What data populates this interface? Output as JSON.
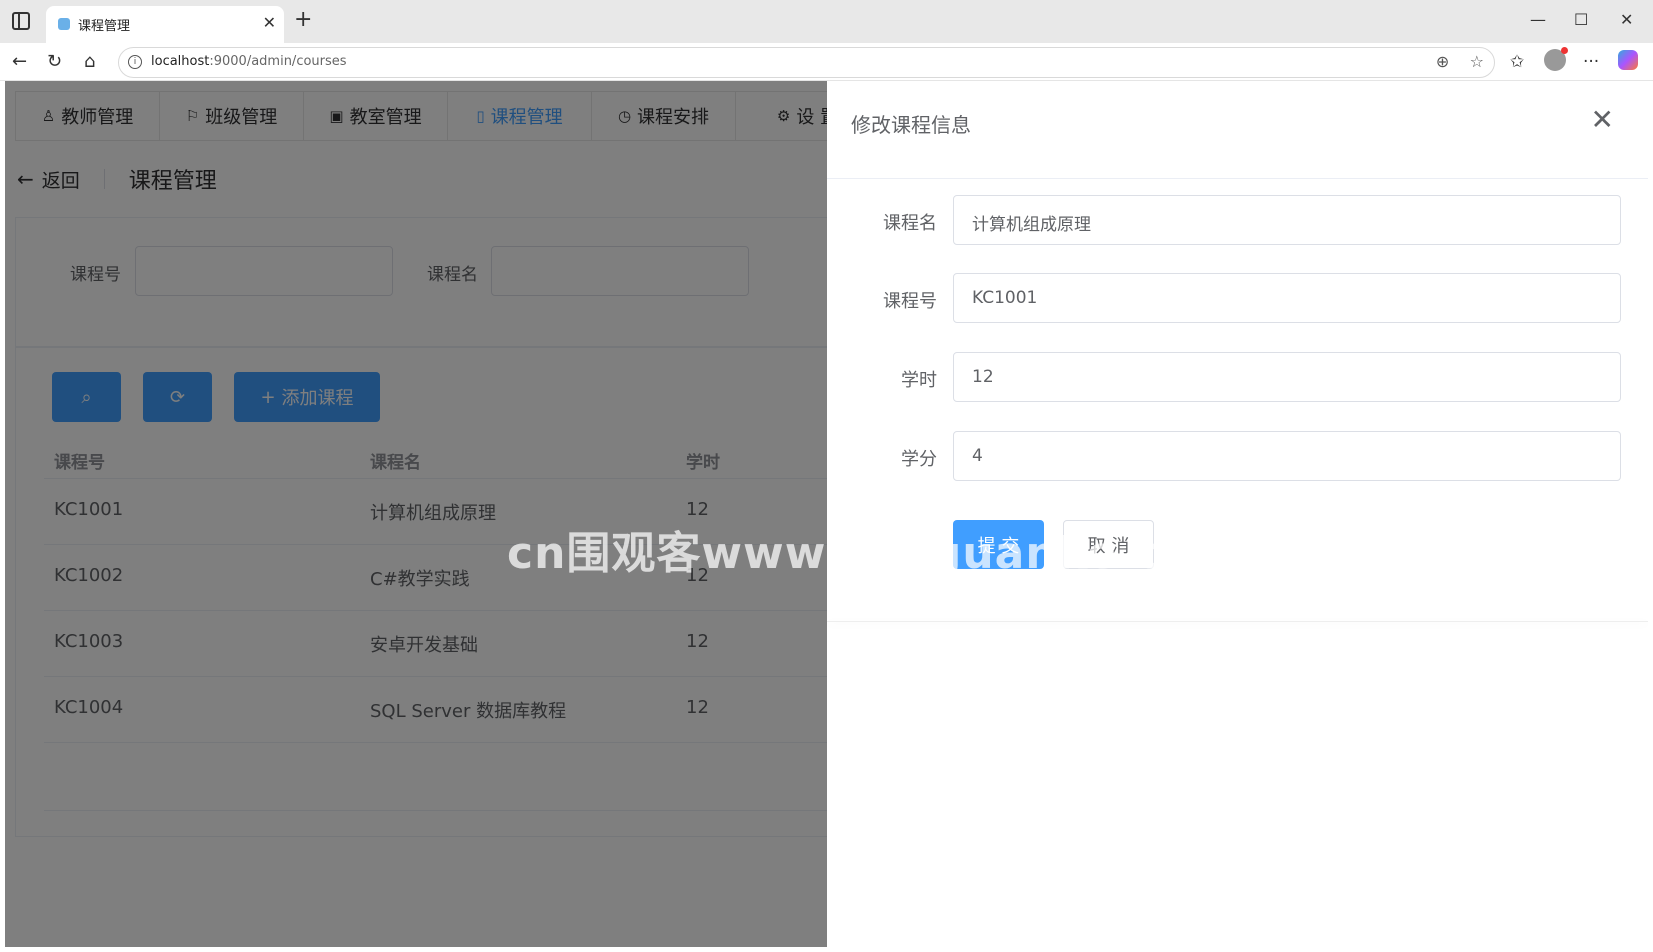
{
  "browser": {
    "tab_title": "课程管理",
    "url_host": "localhost",
    "url_rest": ":9000/admin/courses"
  },
  "nav": {
    "items": [
      {
        "label": "教师管理",
        "icon": "user-icon"
      },
      {
        "label": "班级管理",
        "icon": "flag-icon"
      },
      {
        "label": "教室管理",
        "icon": "building-icon"
      },
      {
        "label": "课程管理",
        "icon": "book-icon",
        "active": true
      },
      {
        "label": "课程安排",
        "icon": "watch-icon"
      },
      {
        "label": "设 置",
        "icon": "gear-icon"
      }
    ]
  },
  "header": {
    "back_label": "返回",
    "title": "课程管理"
  },
  "search": {
    "course_no_label": "课程号",
    "course_name_label": "课程名"
  },
  "toolbar": {
    "add_label": "添加课程"
  },
  "table": {
    "headers": [
      "课程号",
      "课程名",
      "学时"
    ],
    "rows": [
      [
        "KC1001",
        "计算机组成原理",
        "12"
      ],
      [
        "KC1002",
        "C#教学实践",
        "12"
      ],
      [
        "KC1003",
        "安卓开发基础",
        "12"
      ],
      [
        "KC1004",
        "SQL Server 数据库教程",
        "12"
      ]
    ]
  },
  "dialog": {
    "title": "修改课程信息",
    "fields": [
      {
        "label": "课程名",
        "value": "计算机组成原理"
      },
      {
        "label": "课程号",
        "value": "KC1001"
      },
      {
        "label": "学时",
        "value": "12"
      },
      {
        "label": "学分",
        "value": "4"
      }
    ],
    "submit_label": "提 交",
    "cancel_label": "取 消"
  },
  "watermark": "cn围观客www.weiguanke.cn",
  "colors": {
    "primary": "#409eff",
    "overlay": "rgba(0,0,0,0.5)"
  }
}
